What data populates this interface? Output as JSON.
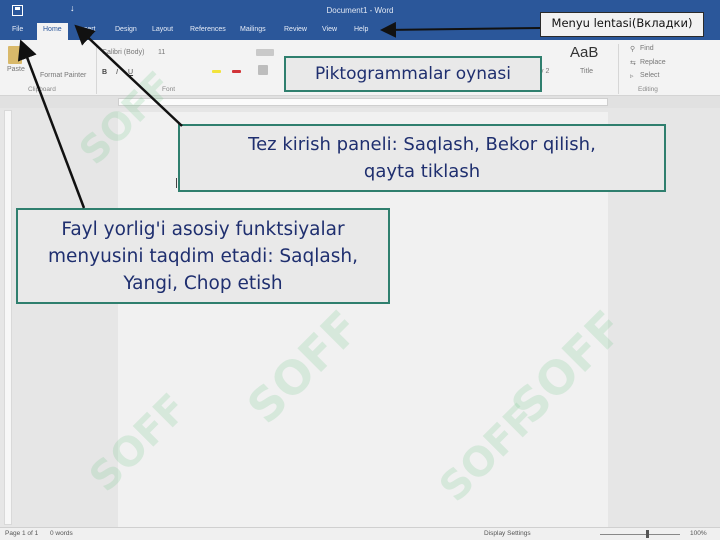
{
  "window": {
    "title": "Document1 - Word",
    "qat_mark": "↓"
  },
  "tabs": [
    {
      "label": "File"
    },
    {
      "label": "Home"
    },
    {
      "label": "Insert"
    },
    {
      "label": "Design"
    },
    {
      "label": "Layout"
    },
    {
      "label": "References"
    },
    {
      "label": "Mailings"
    },
    {
      "label": "Review"
    },
    {
      "label": "View"
    },
    {
      "label": "Help"
    }
  ],
  "ribbon": {
    "paste": "Paste",
    "format_painter": "Format Painter",
    "font_name": "Calibri (Body)",
    "font_size": "11",
    "aab": "AaB",
    "title_style": "Title",
    "find": "Find",
    "replace": "Replace",
    "select": "Select",
    "groups": {
      "clipboard": "Clipboard",
      "font": "Font",
      "editing": "Editing"
    }
  },
  "statusbar": {
    "page": "Page 1 of 1",
    "words": "0 words",
    "display": "Display Settings",
    "zoom": "100%"
  },
  "callouts": {
    "menu_ribbon": "Menyu lentasi(Вкладки)",
    "icons_window": "Piktogrammalar oynasi",
    "qat": [
      "Tez kirish paneli: Saqlash, Bekor qilish,",
      "qayta tiklash"
    ],
    "file_tab": [
      "Fayl yorlig'i asosiy funktsiyalar",
      "menyusini taqdim etadi: Saqlash,",
      "Yangi, Chop etish"
    ]
  },
  "watermark": {
    "text": "SOFF"
  },
  "colors": {
    "word_blue": "#2b579a",
    "callout_border": "#2f7f6e",
    "callout_text": "#1f2f6f"
  }
}
